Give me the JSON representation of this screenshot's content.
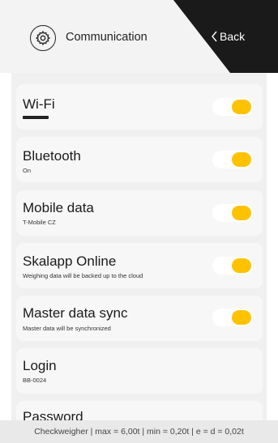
{
  "header": {
    "title": "Communication",
    "back_label": "Back"
  },
  "items": [
    {
      "title": "Wi-Fi",
      "subtitle": "",
      "toggle": true,
      "redacted_subtitle": true
    },
    {
      "title": "Bluetooth",
      "subtitle": "On",
      "toggle": true
    },
    {
      "title": "Mobile data",
      "subtitle": "T-Mobile CZ",
      "toggle": true
    },
    {
      "title": "Skalapp Online",
      "subtitle": "Weighing data will be backed up to the cloud",
      "toggle": true
    },
    {
      "title": "Master data sync",
      "subtitle": "Master data will be synchronized",
      "toggle": true
    },
    {
      "title": "Login",
      "subtitle": "BB-0024",
      "toggle": null
    },
    {
      "title": "Password",
      "subtitle": "",
      "toggle": null
    }
  ],
  "footer": {
    "text": "Checkweigher | max = 6,00t | min = 0,20t | e = d = 0,02t"
  },
  "colors": {
    "accent": "#ffc200",
    "header_bg": "#f3f3f3",
    "back_bg": "#1a1a1a"
  }
}
